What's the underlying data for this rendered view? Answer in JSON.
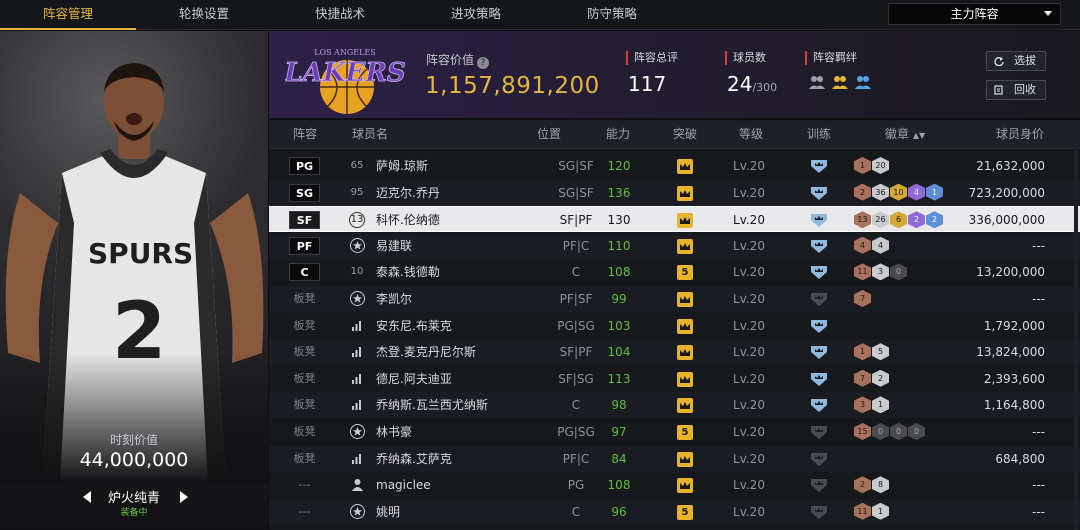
{
  "tabs": [
    {
      "label": "阵容管理",
      "active": true
    },
    {
      "label": "轮换设置",
      "active": false
    },
    {
      "label": "快捷战术",
      "active": false
    },
    {
      "label": "进攻策略",
      "active": false
    },
    {
      "label": "防守策略",
      "active": false
    }
  ],
  "lineup_select": {
    "value": "主力阵容"
  },
  "left_panel": {
    "moment_label": "时刻价值",
    "moment_value": "44,000,000",
    "skin_name": "炉火纯青",
    "skin_status": "装备中",
    "jersey_team": "SPURS",
    "jersey_number": "2"
  },
  "header": {
    "team_logo_text": "LAKERS",
    "team_logo_sub": "LOS ANGELES",
    "value_label": "阵容价值",
    "value_number": "1,157,891,200",
    "rating_label": "阵容总评",
    "rating_value": "117",
    "players_label": "球员数",
    "players_value": "24",
    "players_max": "/300",
    "bond_label": "阵容羁绊",
    "select_button": "选拔",
    "recycle_button": "回收"
  },
  "table": {
    "headers": {
      "lineup": "阵容",
      "name": "球员名",
      "position": "位置",
      "ability": "能力",
      "break": "突破",
      "level": "等级",
      "training": "训练",
      "badge": "徽章",
      "salary": "球员身价"
    },
    "rows": [
      {
        "slot": "PG",
        "num": "65",
        "name": "萨姆.琼斯",
        "pos": "SG|SF",
        "ability": "120",
        "break": "crown",
        "level": "Lv.20",
        "train": "blue",
        "badges": [
          [
            "b-bronze",
            "1"
          ],
          [
            "b-silver",
            "20"
          ]
        ],
        "salary": "21,632,000"
      },
      {
        "slot": "SG",
        "num": "95",
        "name": "迈克尔.乔丹",
        "pos": "SG|SF",
        "ability": "136",
        "break": "crown",
        "level": "Lv.20",
        "train": "blue",
        "badges": [
          [
            "b-bronze",
            "2"
          ],
          [
            "b-silver",
            "36"
          ],
          [
            "b-gold",
            "10"
          ],
          [
            "b-purple",
            "4"
          ],
          [
            "b-blue",
            "1"
          ]
        ],
        "salary": "723,200,000"
      },
      {
        "slot": "SF",
        "num": "13",
        "name": "科怀.伦纳德",
        "pos": "SF|PF",
        "ability": "130",
        "break": "crown",
        "level": "Lv.20",
        "train": "blue",
        "badges": [
          [
            "b-bronze",
            "13"
          ],
          [
            "b-silver",
            "26"
          ],
          [
            "b-gold",
            "6"
          ],
          [
            "b-purple",
            "2"
          ],
          [
            "b-blue",
            "2"
          ]
        ],
        "salary": "336,000,000"
      },
      {
        "slot": "PF",
        "num": "",
        "icon": "star",
        "name": "易建联",
        "pos": "PF|C",
        "ability": "110",
        "break": "crown",
        "level": "Lv.20",
        "train": "blue",
        "badges": [
          [
            "b-bronze",
            "4"
          ],
          [
            "b-silver",
            "4"
          ]
        ],
        "salary": "---"
      },
      {
        "slot": "C",
        "num": "10",
        "name": "泰森.钱德勒",
        "pos": "C",
        "ability": "108",
        "break": "5",
        "level": "Lv.20",
        "train": "blue",
        "badges": [
          [
            "b-bronze",
            "11"
          ],
          [
            "b-silver",
            "3"
          ],
          [
            "b-dark",
            "0"
          ]
        ],
        "salary": "13,200,000"
      },
      {
        "slot": "板凳",
        "num": "",
        "icon": "star",
        "name": "李凯尔",
        "pos": "PF|SF",
        "ability": "99",
        "break": "crown",
        "level": "Lv.20",
        "train": "gray",
        "badges": [
          [
            "b-bronze",
            "7"
          ]
        ],
        "salary": "---"
      },
      {
        "slot": "板凳",
        "num": "",
        "icon": "bars",
        "name": "安东尼.布莱克",
        "pos": "PG|SG",
        "ability": "103",
        "break": "crown",
        "level": "Lv.20",
        "train": "blue",
        "badges": [],
        "salary": "1,792,000"
      },
      {
        "slot": "板凳",
        "num": "",
        "icon": "bars",
        "name": "杰登.麦克丹尼尔斯",
        "pos": "SF|PF",
        "ability": "104",
        "break": "crown",
        "level": "Lv.20",
        "train": "blue",
        "badges": [
          [
            "b-bronze",
            "1"
          ],
          [
            "b-silver",
            "5"
          ]
        ],
        "salary": "13,824,000"
      },
      {
        "slot": "板凳",
        "num": "",
        "icon": "bars",
        "name": "德尼.阿夫迪亚",
        "pos": "SF|SG",
        "ability": "113",
        "break": "crown",
        "level": "Lv.20",
        "train": "blue",
        "badges": [
          [
            "b-bronze",
            "7"
          ],
          [
            "b-silver",
            "2"
          ]
        ],
        "salary": "2,393,600"
      },
      {
        "slot": "板凳",
        "num": "",
        "icon": "bars",
        "name": "乔纳斯.瓦兰西尤纳斯",
        "pos": "C",
        "ability": "98",
        "break": "crown",
        "level": "Lv.20",
        "train": "blue",
        "badges": [
          [
            "b-bronze",
            "3"
          ],
          [
            "b-silver",
            "1"
          ]
        ],
        "salary": "1,164,800"
      },
      {
        "slot": "板凳",
        "num": "",
        "icon": "star",
        "name": "林书豪",
        "pos": "PG|SG",
        "ability": "97",
        "break": "5",
        "level": "Lv.20",
        "train": "gray",
        "badges": [
          [
            "b-bronze",
            "15"
          ],
          [
            "b-dark",
            "0"
          ],
          [
            "b-dark",
            "0"
          ],
          [
            "b-dark",
            "0"
          ]
        ],
        "salary": "---"
      },
      {
        "slot": "板凳",
        "num": "",
        "icon": "bars",
        "name": "乔纳森.艾萨克",
        "pos": "PF|C",
        "ability": "84",
        "break": "crown",
        "level": "Lv.20",
        "train": "gray",
        "badges": [],
        "salary": "684,800"
      },
      {
        "slot": "---",
        "num": "",
        "icon": "person",
        "name": "magiclee",
        "pos": "PG",
        "ability": "108",
        "break": "crown",
        "level": "Lv.20",
        "train": "gray",
        "badges": [
          [
            "b-bronze",
            "2"
          ],
          [
            "b-silver",
            "8"
          ]
        ],
        "salary": "---"
      },
      {
        "slot": "---",
        "num": "",
        "icon": "star",
        "name": "姚明",
        "pos": "C",
        "ability": "96",
        "break": "5",
        "level": "Lv.20",
        "train": "gray",
        "badges": [
          [
            "b-bronze",
            "11"
          ],
          [
            "b-silver",
            "1"
          ]
        ],
        "salary": "---"
      }
    ]
  },
  "colors": {
    "accent": "#e3b740",
    "ability": "#5cbf3a",
    "header_bg": "#2d2148",
    "selected_row": "#e9e9eb"
  }
}
